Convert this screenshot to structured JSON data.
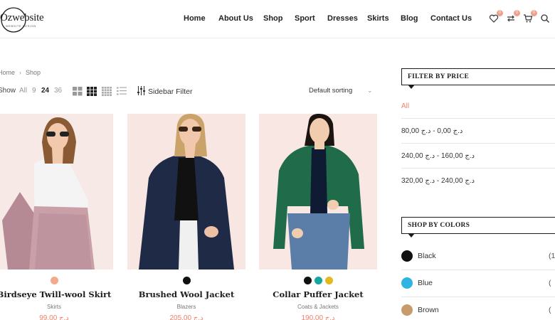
{
  "header": {
    "logo_text": "Ozwebsite",
    "logo_sub": "WEBSITE DESIGN",
    "nav": [
      "Home",
      "About Us",
      "Shop",
      "Sport",
      "Dresses",
      "Skirts",
      "Blog",
      "Contact Us"
    ],
    "wishlist_count": "0",
    "compare_count": "0",
    "cart_count": "0"
  },
  "breadcrumb": {
    "home": "Home",
    "sep": "›",
    "current": "Shop"
  },
  "toolbar": {
    "show_label": "Show",
    "options": [
      "All",
      "9",
      "24",
      "36"
    ],
    "active_option": "24",
    "sidebar_filter": "Sidebar Filter",
    "sorting": "Default sorting",
    "sorting_chevron": "⌄"
  },
  "products": [
    {
      "name": "Birdseye Twill-wool Skirt",
      "category": "Skirts",
      "price": "99,00 د.ج",
      "swatches": [
        "#f2a98c"
      ]
    },
    {
      "name": "Brushed Wool Jacket",
      "category": "Blazers",
      "price": "205,00 د.ج",
      "swatches": [
        "#111111"
      ]
    },
    {
      "name": "Collar Puffer Jacket",
      "category": "Coats & Jackets",
      "price": "190,00 د.ج",
      "swatches": [
        "#111111",
        "#17a6a0",
        "#e5b81c"
      ]
    }
  ],
  "filter_price": {
    "title": "FILTER BY PRICE",
    "items": [
      "All",
      "د.ج 0,00 - د.ج 80,00",
      "د.ج 160,00 - د.ج 240,00",
      "د.ج 240,00 - د.ج 320,00"
    ]
  },
  "shop_colors": {
    "title": "SHOP BY COLORS",
    "items": [
      {
        "label": "Black",
        "count": "(1",
        "color": "#111111"
      },
      {
        "label": "Blue",
        "count": "(",
        "color": "#2fb3e0"
      },
      {
        "label": "Brown",
        "count": "(",
        "color": "#c89b6d"
      }
    ]
  },
  "colors": {
    "accent": "#f0826a",
    "badge": "#f0a08a"
  }
}
